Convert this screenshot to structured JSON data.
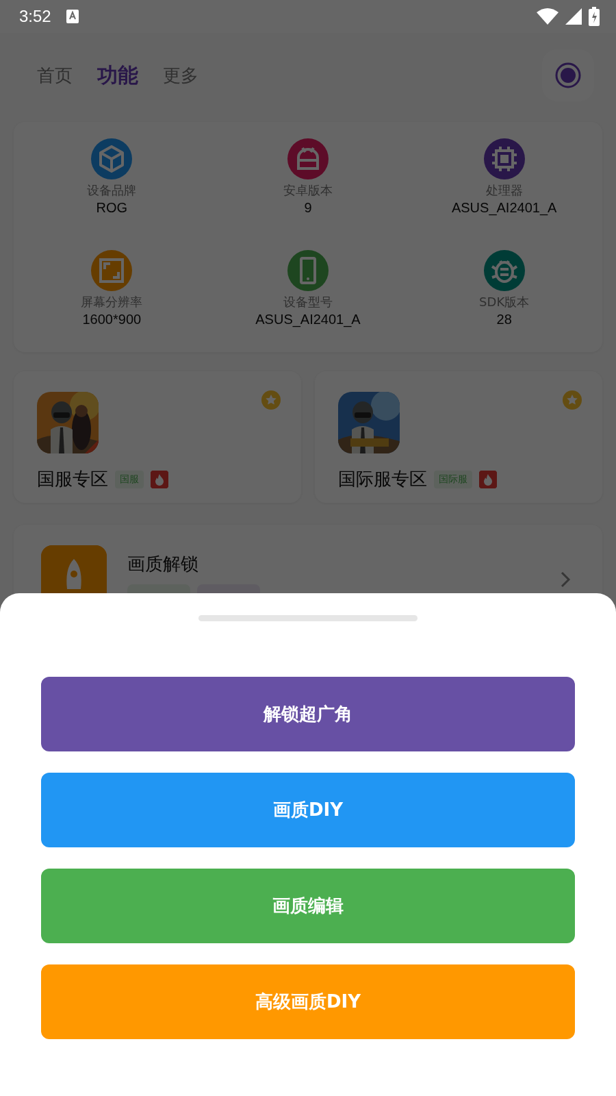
{
  "status_bar": {
    "time": "3:52"
  },
  "tabs": [
    {
      "label": "首页",
      "selected": false
    },
    {
      "label": "功能",
      "selected": true
    },
    {
      "label": "更多",
      "selected": false
    }
  ],
  "device_info": [
    {
      "label": "设备品牌",
      "value": "ROG"
    },
    {
      "label": "安卓版本",
      "value": "9"
    },
    {
      "label": "处理器",
      "value": "ASUS_AI2401_A"
    },
    {
      "label": "屏幕分辨率",
      "value": "1600*900"
    },
    {
      "label": "设备型号",
      "value": "ASUS_AI2401_A"
    },
    {
      "label": "SDK版本",
      "value": "28"
    }
  ],
  "games": [
    {
      "title": "国服专区",
      "tag": "国服"
    },
    {
      "title": "国际服专区",
      "tag": "国际服"
    }
  ],
  "feature": {
    "title": "画质解锁"
  },
  "sheet_buttons": [
    {
      "label": "解锁超广角",
      "color": "#6750a4"
    },
    {
      "label": "画质DIY",
      "color": "#2196f3"
    },
    {
      "label": "画质编辑",
      "color": "#4caf50"
    },
    {
      "label": "高级画质DIY",
      "color": "#ff9800"
    }
  ]
}
